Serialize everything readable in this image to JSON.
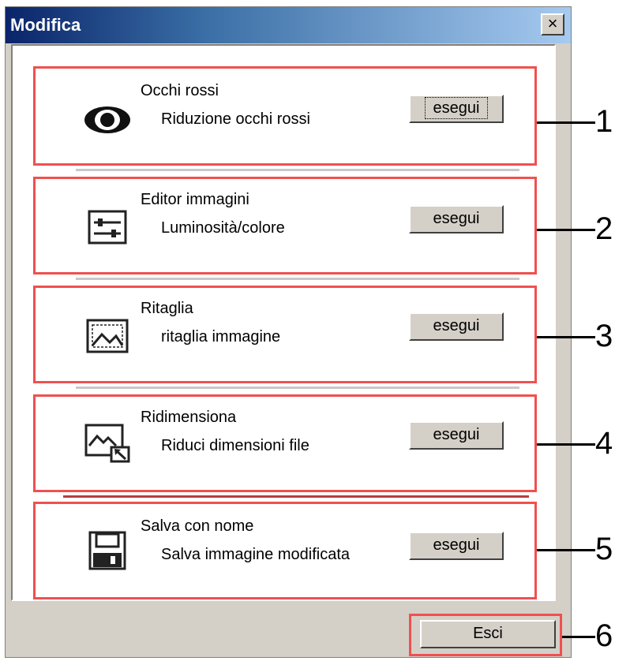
{
  "window": {
    "title": "Modifica",
    "close_label": "×"
  },
  "sections": [
    {
      "heading": "Occhi rossi",
      "description": "Riduzione occhi rossi",
      "button": "esegui",
      "callout": "1",
      "icon": "eye-icon"
    },
    {
      "heading": "Editor immagini",
      "description": "Luminosità/colore",
      "button": "esegui",
      "callout": "2",
      "icon": "sliders-icon"
    },
    {
      "heading": "Ritaglia",
      "description": "ritaglia immagine",
      "button": "esegui",
      "callout": "3",
      "icon": "crop-image-icon"
    },
    {
      "heading": "Ridimensiona",
      "description": "Riduci dimensioni file",
      "button": "esegui",
      "callout": "4",
      "icon": "resize-image-icon"
    },
    {
      "heading": "Salva con nome",
      "description": "Salva immagine modificata",
      "button": "esegui",
      "callout": "5",
      "icon": "floppy-disk-icon"
    }
  ],
  "footer": {
    "exit_label": "Esci",
    "callout": "6"
  },
  "colors": {
    "highlight": "#f05050",
    "titlebar_start": "#0a246a",
    "titlebar_end": "#a6caf0"
  }
}
